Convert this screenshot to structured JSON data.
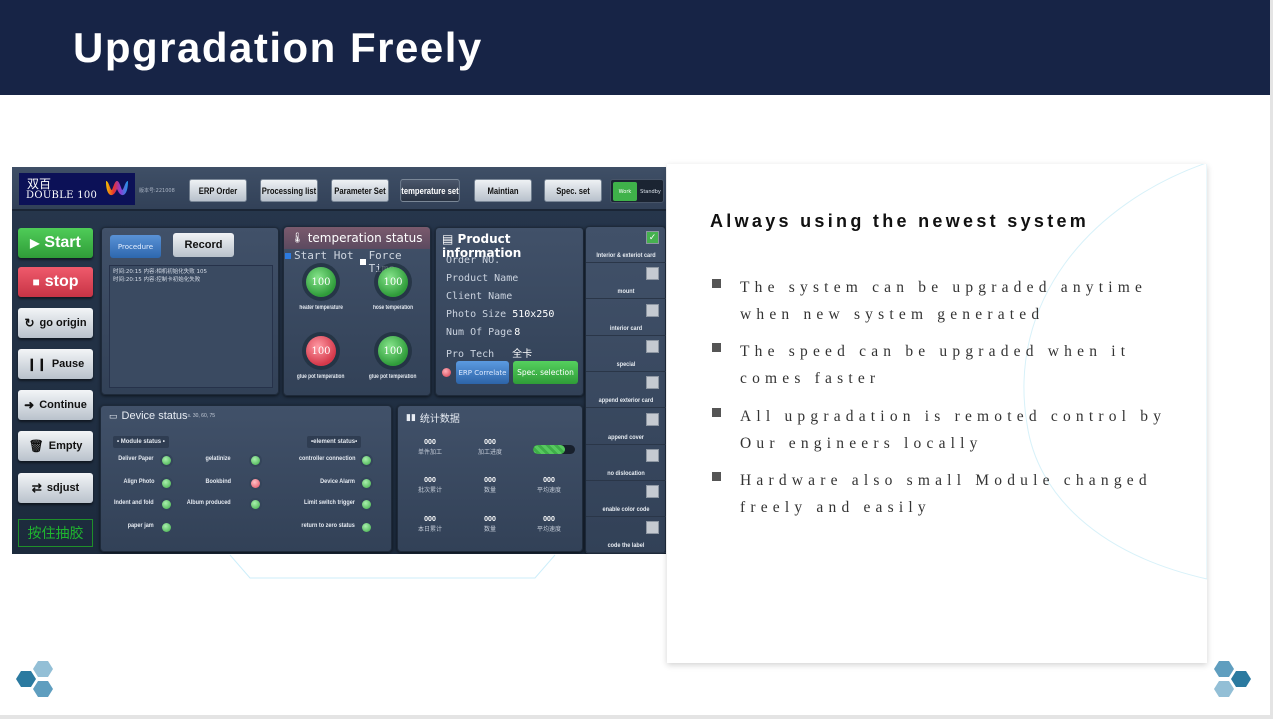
{
  "header": {
    "title": "Upgradation Freely"
  },
  "hmi": {
    "logo": {
      "cn": "双百",
      "en": "DOUBLE 100"
    },
    "version": "版本号:221008",
    "top_buttons": [
      "ERP Order",
      "Processing list",
      "Parameter Set",
      "temperature set",
      "Maintian",
      "Spec. set"
    ],
    "mode_toggle": {
      "on": "Work",
      "off": "Standby"
    },
    "side_buttons": [
      {
        "label": "Start",
        "icon": "play-icon"
      },
      {
        "label": "stop",
        "icon": "stop-icon"
      },
      {
        "label": "go origin",
        "icon": "refresh-icon"
      },
      {
        "label": "Pause",
        "icon": "pause-icon"
      },
      {
        "label": "Continue",
        "icon": "arrow-right-icon"
      },
      {
        "label": "Empty",
        "icon": "trash-icon"
      },
      {
        "label": "sdjust",
        "icon": "sliders-icon"
      }
    ],
    "hold_glue": "按住抽胶",
    "log_panel": {
      "procedure_label": "Procedure",
      "record_label": "Record",
      "entries": [
        "时间:20:15   内容:相机初始化失败 105",
        "时间:20:15   内容:控制卡初始化失败"
      ]
    },
    "temperature": {
      "title": "temperation status",
      "start_hot": {
        "label": "Start Hot",
        "checked": true
      },
      "force_time": {
        "label": "Force Time",
        "checked": false
      },
      "gauges": [
        {
          "value": "100",
          "label": "heater temperature",
          "status": "ok"
        },
        {
          "value": "100",
          "label": "hose temperation",
          "status": "ok"
        },
        {
          "value": "100",
          "label": "glue pot temperation",
          "status": "alarm"
        },
        {
          "value": "100",
          "label": "glue pot temperation",
          "status": "ok"
        }
      ]
    },
    "product": {
      "title": "Product information",
      "rows": [
        {
          "label": "Order NO.",
          "value": ""
        },
        {
          "label": "Product Name",
          "value": ""
        },
        {
          "label": "Client Name",
          "value": ""
        },
        {
          "label": "Photo Size",
          "value": "510x250"
        },
        {
          "label": "Num Of Page",
          "value": "8"
        },
        {
          "label": "Pro Tech",
          "value": "全卡"
        }
      ],
      "erp_button": "ERP Correlate",
      "spec_button": "Spec. selection"
    },
    "options": [
      {
        "label": "Interior & exteriot card",
        "checked": true
      },
      {
        "label": "mount",
        "checked": false
      },
      {
        "label": "interior card",
        "checked": false
      },
      {
        "label": "special",
        "checked": false
      },
      {
        "label": "append exterior card",
        "checked": false
      },
      {
        "label": "append cover",
        "checked": false
      },
      {
        "label": "no dislocation",
        "checked": false
      },
      {
        "label": "enable color code",
        "checked": false
      },
      {
        "label": "code the label",
        "checked": false
      }
    ],
    "device": {
      "title": "Device status",
      "subtitle": "s. 30, 60, 75",
      "module_label": "• Module status •",
      "element_label": "•element status•",
      "module_items": [
        {
          "label": "Deliver Paper",
          "status": "ok"
        },
        {
          "label": "Align Photo",
          "status": "ok"
        },
        {
          "label": "Indent and fold",
          "status": "ok"
        },
        {
          "label": "paper jam",
          "status": "ok"
        },
        {
          "label": "gelatinize",
          "status": "ok"
        },
        {
          "label": "Bookbind",
          "status": "alarm"
        },
        {
          "label": "Album produced",
          "status": "ok"
        }
      ],
      "element_items": [
        {
          "label": "controller connection",
          "status": "ok"
        },
        {
          "label": "Device Alarm",
          "status": "ok"
        },
        {
          "label": "Limit switch trigger",
          "status": "ok"
        },
        {
          "label": "return to zero status",
          "status": "ok"
        }
      ]
    },
    "stats": {
      "title": "统计数据",
      "progress_percent": 75,
      "cells": [
        {
          "num": "000",
          "cap": "单件加工"
        },
        {
          "num": "000",
          "cap": "加工进度"
        },
        {
          "num": "000",
          "cap": "批次累计"
        },
        {
          "num": "000",
          "cap": "数量"
        },
        {
          "num": "000",
          "cap": "平均速度"
        },
        {
          "num": "000",
          "cap": "本日累计"
        },
        {
          "num": "000",
          "cap": "数量"
        },
        {
          "num": "000",
          "cap": "平均速度"
        }
      ]
    }
  },
  "card": {
    "title": "Always using the newest system",
    "bullets": [
      "The system can be upgraded anytime when new system generated",
      "The speed can be upgraded when it comes faster",
      "All upgradation is remoted control by Our engineers locally",
      "Hardware also small Module changed freely and easily"
    ]
  },
  "colors": {
    "header_bg": "#172446",
    "accent_green": "#3fb24a",
    "accent_red": "#d5384a",
    "hex_dark": "#2b7aa0",
    "hex_mid": "#5f9ebf",
    "hex_light": "#93bfd6"
  }
}
